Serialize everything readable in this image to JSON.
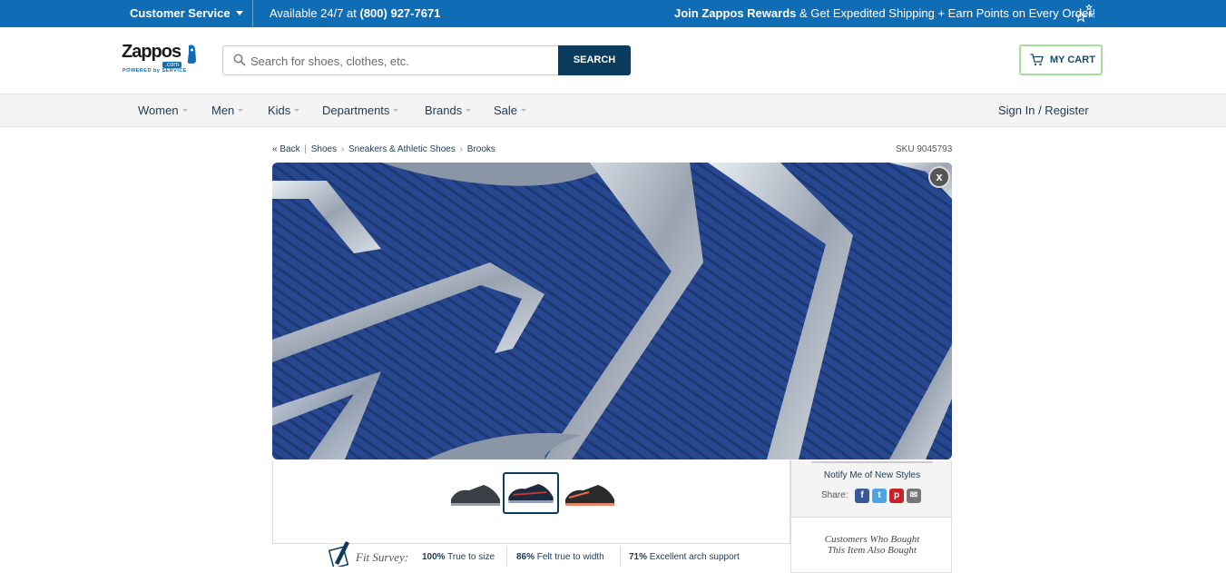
{
  "topbar": {
    "customer_service": "Customer Service",
    "availability_prefix": "Available 24/7 at ",
    "phone": "(800) 927-7671",
    "rewards_bold": "Join Zappos Rewards",
    "rewards_rest": " & Get Expedited Shipping + Earn Points on Every Order!"
  },
  "header": {
    "logo_word": "Zappos",
    "logo_dotcom": ".com",
    "logo_tagline": "POWERED by SERVICE",
    "search_placeholder": "Search for shoes, clothes, etc.",
    "search_button": "SEARCH",
    "cart_label": "MY CART"
  },
  "nav": {
    "items": [
      "Women",
      "Men",
      "Kids",
      "Departments",
      "Brands",
      "Sale"
    ],
    "signin": "Sign In / Register"
  },
  "breadcrumb": {
    "back": "« Back",
    "items": [
      "Shoes",
      "Sneakers & Athletic Shoes",
      "Brooks"
    ]
  },
  "sku": "SKU 9045793",
  "close_label": "x",
  "sidebar": {
    "notify": "Notify Me of New Styles",
    "share_label": "Share:",
    "social": [
      {
        "name": "facebook",
        "glyph": "f",
        "color": "#3b5998"
      },
      {
        "name": "twitter",
        "glyph": "t",
        "color": "#4ea4e6"
      },
      {
        "name": "pinterest",
        "glyph": "p",
        "color": "#cb2027"
      },
      {
        "name": "email",
        "glyph": "✉",
        "color": "#777777"
      }
    ],
    "also_bought_line1": "Customers Who Bought",
    "also_bought_line2": "This Item Also Bought"
  },
  "fit_survey": {
    "label": "Fit Survey:",
    "stats": [
      {
        "pct": "100%",
        "text": " True to size"
      },
      {
        "pct": "86%",
        "text": " Felt true to width"
      },
      {
        "pct": "71%",
        "text": " Excellent arch support"
      }
    ]
  },
  "colors": {
    "topbar": "#0f6db5",
    "dark_navy": "#0c3c5d",
    "cart_border": "#a7dc9e",
    "sole_blue": "#233f80"
  }
}
